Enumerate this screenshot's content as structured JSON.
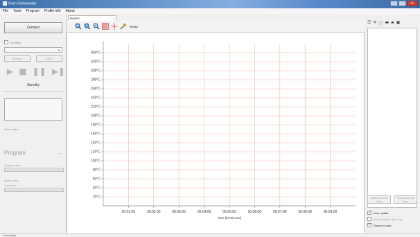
{
  "window": {
    "title": "Oven Commander"
  },
  "menu": [
    "File",
    "Tools",
    "Program",
    "Profile info",
    "About"
  ],
  "left": {
    "connect_label": "Connect",
    "modified_label": "Modified",
    "remove_label": "Remove",
    "store_label": "Store",
    "state_label": "Standby",
    "oven_status_label": "Oven status",
    "oven_status_value": "---",
    "program_label": "Program",
    "program_value": "-----",
    "program_small_value": "--",
    "program_time_label": "Program time",
    "program_time_value": "-- : --",
    "active_zone_label": "Active zone",
    "active_zone_value": "--",
    "zone_time_label": "Zone time",
    "zone_time_value": "-- : --"
  },
  "tab": {
    "label": "Device",
    "close": "×"
  },
  "toolbar": {
    "setup_label": "Setup"
  },
  "right": {
    "upload_label": "Upload from the Oven",
    "download_label": "Download to the Oven",
    "auto_update": {
      "label": "Auto update",
      "checked": true
    },
    "synchronized": {
      "label": "Synchronised with oven",
      "checked": false
    },
    "show_on_chart": {
      "label": "Show on chart",
      "checked": true
    }
  },
  "status": {
    "text": "Connected"
  },
  "chart_data": {
    "type": "line",
    "xlabel": "Time [hr:min:sec]",
    "ylabel": "",
    "x_ticks": [
      "00:01:00",
      "00:02:00",
      "00:03:00",
      "00:04:00",
      "00:05:00",
      "00:06:00",
      "00:07:00",
      "00:08:00",
      "00:09:00"
    ],
    "y_ticks": [
      "20°C",
      "40°C",
      "60°C",
      "80°C",
      "100°C",
      "120°C",
      "140°C",
      "160°C",
      "180°C",
      "200°C",
      "220°C",
      "240°C",
      "260°C",
      "280°C",
      "300°C",
      "320°C",
      "340°C"
    ],
    "ylim": [
      0,
      360
    ],
    "xlim": [
      "00:00:00",
      "00:10:00"
    ],
    "grid": true,
    "series": []
  }
}
